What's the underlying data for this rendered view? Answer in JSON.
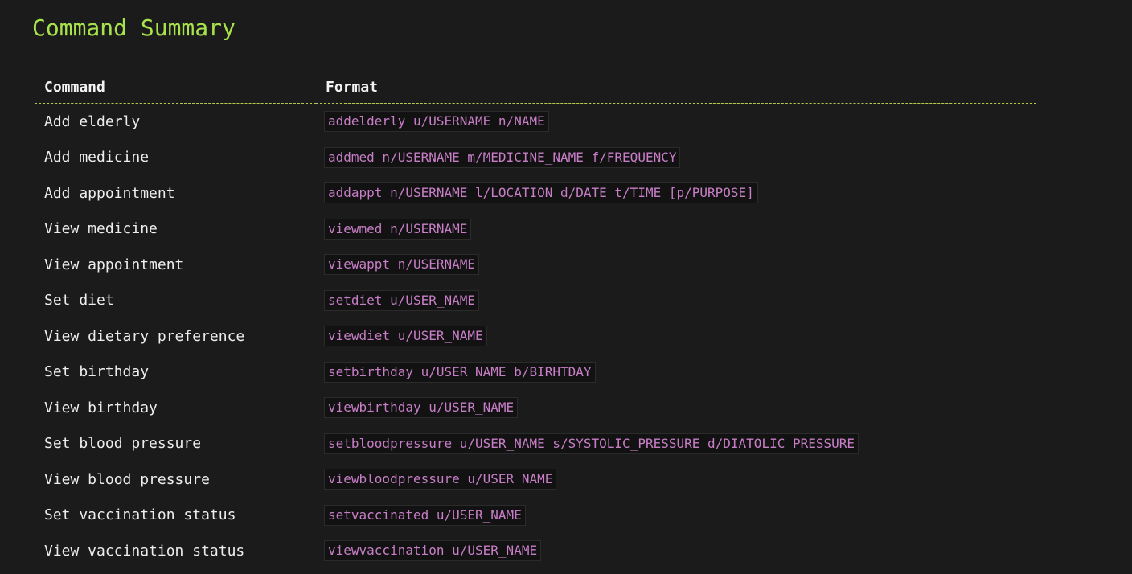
{
  "title": "Command Summary",
  "columns": {
    "command": "Command",
    "format": "Format"
  },
  "rows": [
    {
      "command": "Add elderly",
      "format": "addelderly u/USERNAME n/NAME"
    },
    {
      "command": "Add medicine",
      "format": "addmed n/USERNAME m/MEDICINE_NAME f/FREQUENCY"
    },
    {
      "command": "Add appointment",
      "format": "addappt n/USERNAME l/LOCATION d/DATE t/TIME [p/PURPOSE]"
    },
    {
      "command": "View medicine",
      "format": "viewmed n/USERNAME"
    },
    {
      "command": "View appointment",
      "format": "viewappt n/USERNAME"
    },
    {
      "command": "Set diet",
      "format": "setdiet u/USER_NAME"
    },
    {
      "command": "View dietary preference",
      "format": "viewdiet u/USER_NAME"
    },
    {
      "command": "Set birthday",
      "format": "setbirthday u/USER_NAME b/BIRHTDAY"
    },
    {
      "command": "View birthday",
      "format": "viewbirthday u/USER_NAME"
    },
    {
      "command": "Set blood pressure",
      "format": "setbloodpressure u/USER_NAME s/SYSTOLIC_PRESSURE d/DIATOLIC PRESSURE"
    },
    {
      "command": "View blood pressure",
      "format": "viewbloodpressure u/USER_NAME"
    },
    {
      "command": "Set vaccination status",
      "format": "setvaccinated u/USER_NAME"
    },
    {
      "command": "View vaccination status",
      "format": "viewvaccination u/USER_NAME"
    }
  ],
  "colors": {
    "title": "#a9e34b",
    "code_text": "#c77ec6",
    "background": "#1b1b1b"
  }
}
